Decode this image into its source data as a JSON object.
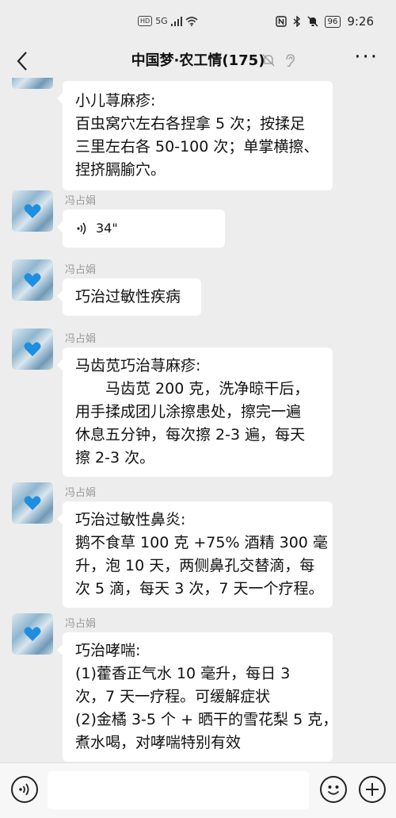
{
  "status_bar": {
    "hd_label": "HD",
    "network_label": "5G",
    "battery_level": "96",
    "time": "9:26"
  },
  "header": {
    "title": "中国梦·农工情(175)",
    "more_label": "···"
  },
  "messages": [
    {
      "type": "text",
      "lines": [
        "小儿荨麻疹:",
        "百虫窝穴左右各捏拿 5 次；按揉足",
        "三里左右各 50-100 次；单掌横擦、",
        "捏挤膈腧穴。"
      ]
    },
    {
      "type": "voice",
      "sender": "冯占娟",
      "duration": "34\""
    },
    {
      "type": "text",
      "sender": "冯占娟",
      "lines": [
        "巧治过敏性疾病"
      ]
    },
    {
      "type": "text",
      "sender": "冯占娟",
      "lines": [
        "马齿苋巧治荨麻疹:",
        "　　马齿苋 200 克，洗净晾干后，",
        "用手揉成团儿涂擦患处，擦完一遍",
        "休息五分钟，每次擦 2-3 遍，每天",
        "擦 2-3 次。"
      ]
    },
    {
      "type": "text",
      "sender": "冯占娟",
      "lines": [
        "巧治过敏性鼻炎:",
        "鹅不食草 100 克 +75% 酒精 300 毫",
        "升，泡 10 天，两侧鼻孔交替滴，每",
        "次 5 滴，每天 3 次，7 天一个疗程。"
      ]
    },
    {
      "type": "text",
      "sender": "冯占娟",
      "lines": [
        "巧治哮喘:",
        "(1)藿香正气水 10 毫升，每日 3",
        "次，7 天一疗程。可缓解症状",
        "(2)金橘 3-5 个 + 晒干的雪花梨 5 克，",
        "煮水喝，对哮喘特别有效"
      ]
    }
  ],
  "input": {
    "value": "",
    "placeholder": ""
  },
  "colors": {
    "background": "#ededed",
    "bubble": "#ffffff",
    "sender_name": "#999999"
  }
}
